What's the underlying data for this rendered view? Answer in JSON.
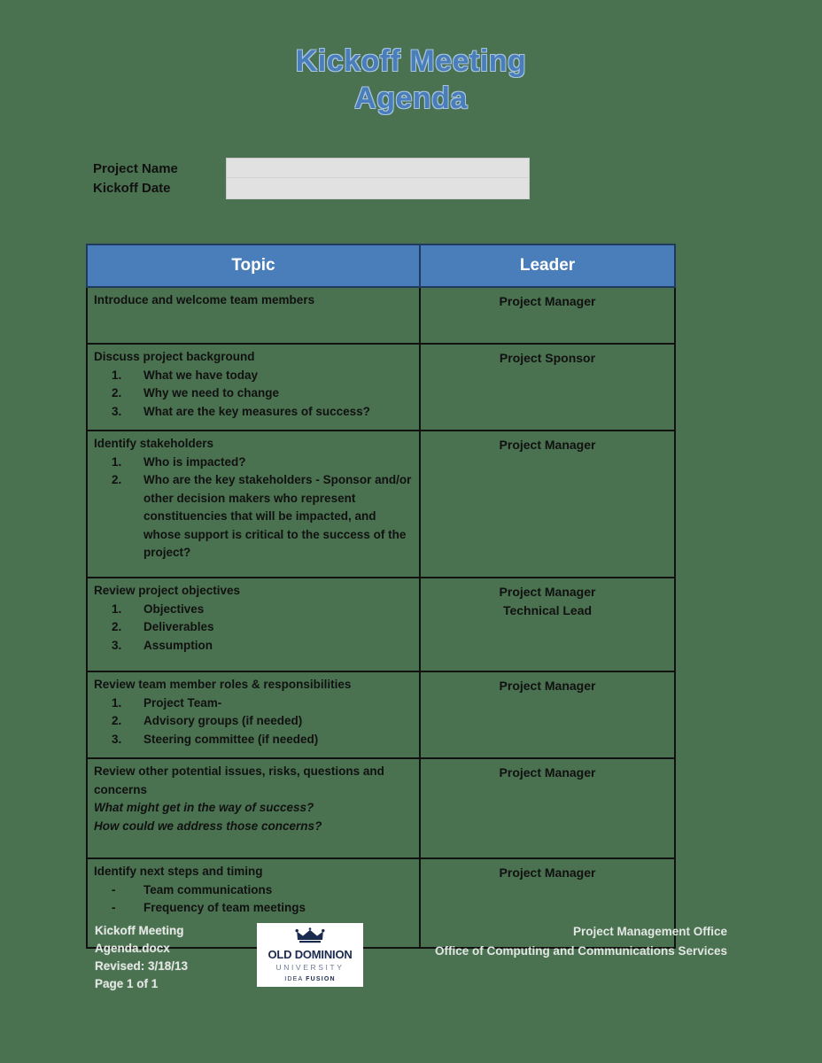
{
  "page": {
    "background_color": "#4a7150",
    "accent_blue": "#4a7ebb"
  },
  "title": {
    "line1": "Kickoff Meeting",
    "line2": "Agenda"
  },
  "form": {
    "project_name_label": "Project Name",
    "kickoff_date_label": "Kickoff Date",
    "project_name_value": "",
    "kickoff_date_value": "",
    "project_name_placeholder": "",
    "kickoff_date_placeholder": ""
  },
  "table": {
    "headers": {
      "topic": "Topic",
      "leader": "Leader"
    },
    "rows": [
      {
        "heading": "Introduce and welcome team members",
        "items": [],
        "extra": [],
        "leader": [
          "Project Manager"
        ]
      },
      {
        "heading": "Discuss project background",
        "items": [
          "What we have today",
          "Why we need to change",
          "What are the key measures of success?"
        ],
        "extra": [],
        "leader": [
          "Project Sponsor"
        ]
      },
      {
        "heading": "Identify stakeholders",
        "items": [
          "Who is impacted?",
          "Who are the key stakeholders - Sponsor and/or other decision makers who represent constituencies that will be impacted, and whose support is critical to the success of the project?"
        ],
        "extra": [],
        "leader": [
          "Project Manager"
        ]
      },
      {
        "heading": "Review project objectives",
        "items": [
          "Objectives",
          "Deliverables",
          "Assumption"
        ],
        "extra": [],
        "leader": [
          "Project Manager",
          "Technical Lead"
        ]
      },
      {
        "heading": "Review team member roles & responsibilities",
        "items": [
          "Project Team-",
          "Advisory groups (if needed)",
          "Steering committee (if needed)"
        ],
        "extra": [],
        "leader": [
          "Project Manager"
        ]
      },
      {
        "heading": "Review other potential issues, risks, questions and concerns",
        "items": [],
        "extra": [
          "What might get in the way of success?",
          "How could we address those concerns?"
        ],
        "leader": [
          "Project Manager"
        ]
      },
      {
        "heading": "Identify next steps and timing",
        "items": [
          "Team communications",
          "Frequency of team meetings"
        ],
        "bullet": "-",
        "extra": [],
        "leader": [
          "Project Manager"
        ]
      }
    ]
  },
  "footer": {
    "left_lines": [
      "Kickoff Meeting",
      "Agenda.docx",
      "Revised: 3/18/13",
      "Page 1 of 1"
    ],
    "right_lines": [
      "Project Management Office",
      "Office of Computing and Communications Services"
    ],
    "logo": {
      "crown": "crown-icon",
      "name": "OLD DOMINION",
      "university": "UNIVERSITY",
      "tag_light": "IDEA ",
      "tag_bold": "FUSION"
    }
  }
}
